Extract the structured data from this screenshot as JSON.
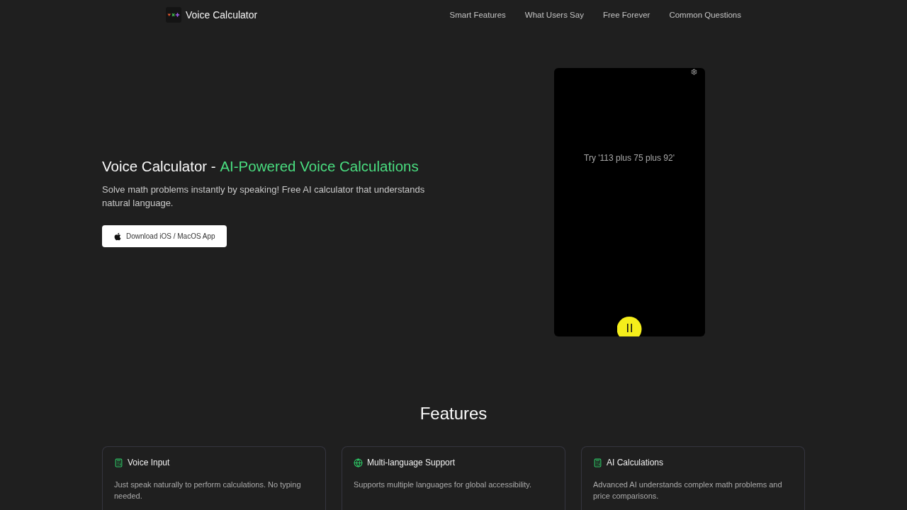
{
  "header": {
    "logo_text": "Voice Calculator",
    "nav": [
      "Smart Features",
      "What Users Say",
      "Free Forever",
      "Common Questions"
    ]
  },
  "hero": {
    "title": "Voice Calculator -",
    "title_highlight": "AI-Powered Voice Calculations",
    "subtitle": "Solve math problems instantly by speaking! Free AI calculator that understands natural language.",
    "download_button": "Download iOS / MacOS App"
  },
  "phone_preview": {
    "hint": "Try '113 plus 75 plus 92'"
  },
  "features": {
    "title": "Features",
    "cards": [
      {
        "title": "Voice Input",
        "description": "Just speak naturally to perform calculations. No typing needed."
      },
      {
        "title": "Multi-language Support",
        "description": "Supports multiple languages for global accessibility."
      },
      {
        "title": "AI Calculations",
        "description": "Advanced AI understands complex math problems and price comparisons."
      }
    ]
  }
}
